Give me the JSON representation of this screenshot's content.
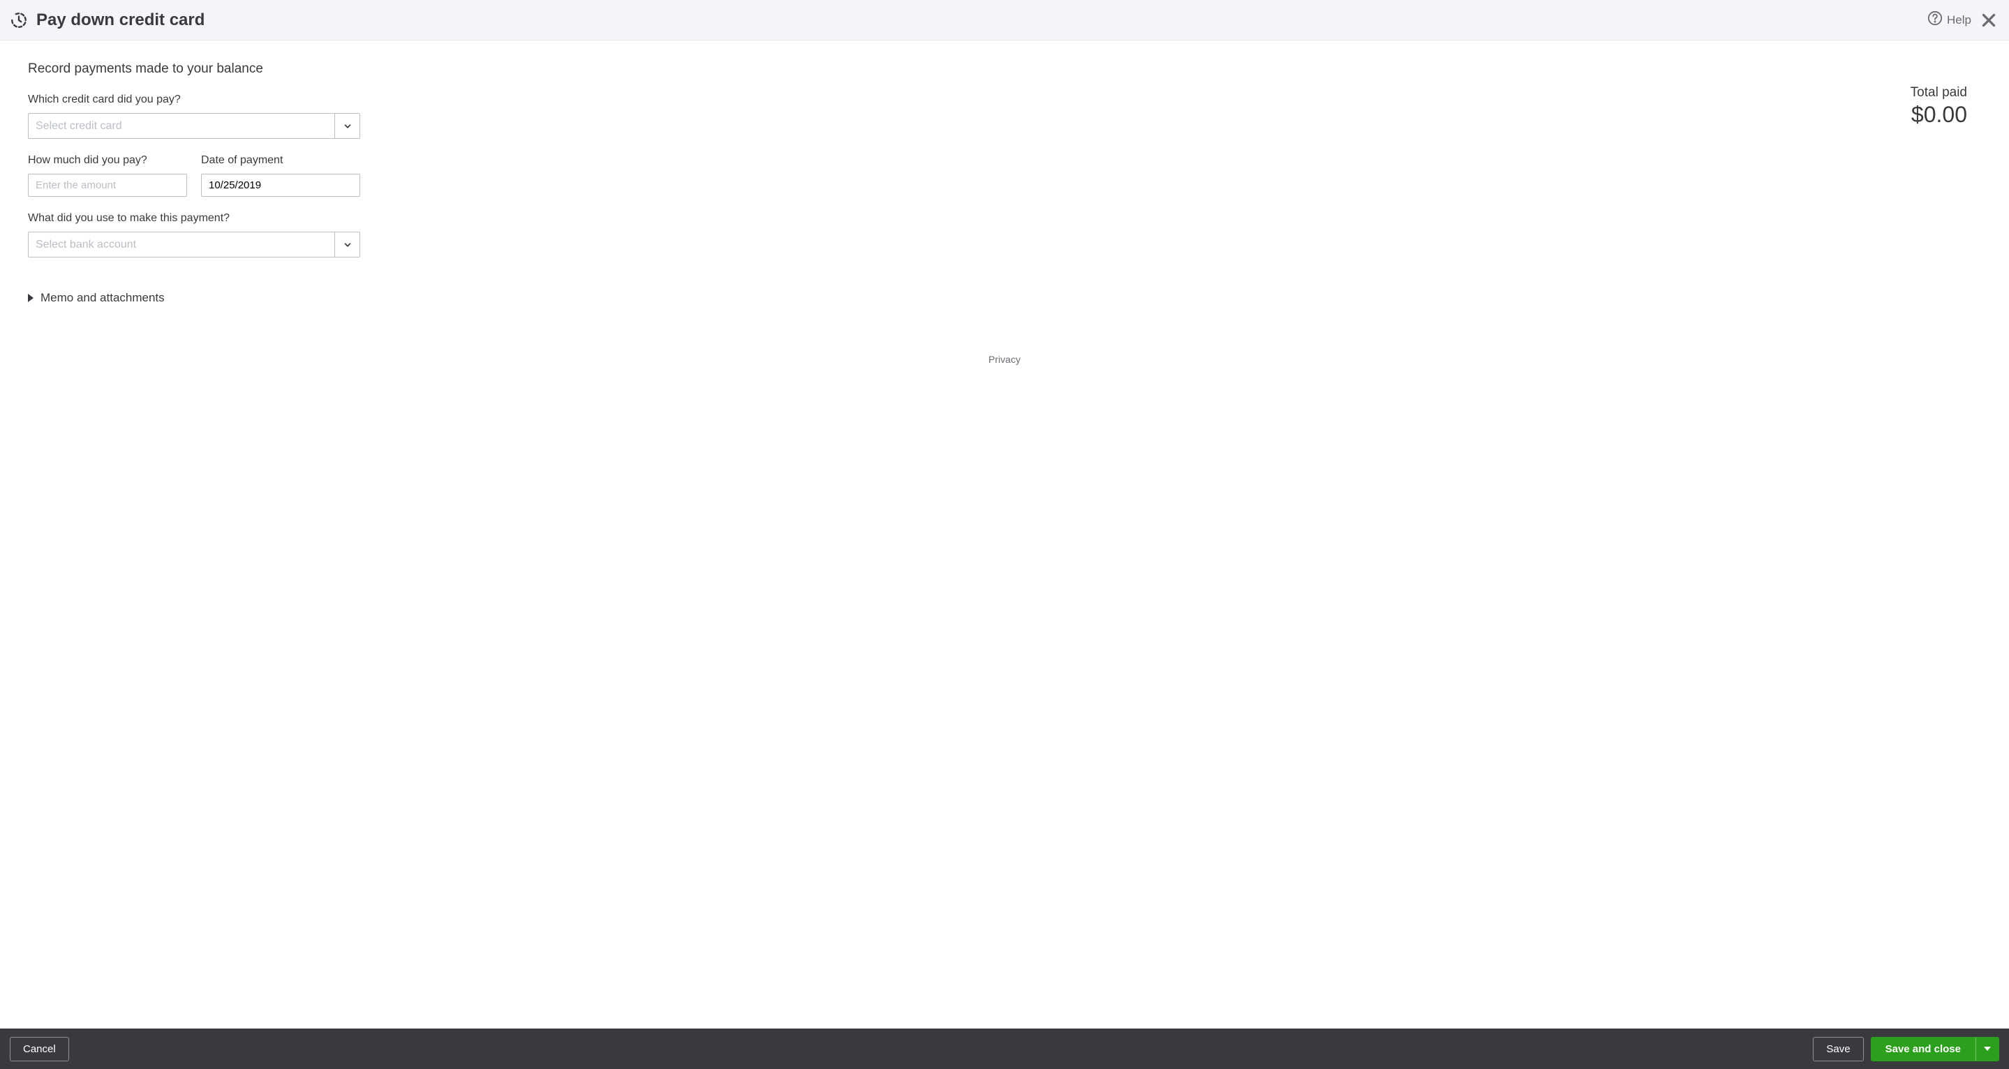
{
  "header": {
    "title": "Pay down credit card",
    "help_label": "Help"
  },
  "content": {
    "subtitle": "Record payments made to your balance",
    "credit_card": {
      "label": "Which credit card did you pay?",
      "placeholder": "Select credit card",
      "value": ""
    },
    "amount": {
      "label": "How much did you pay?",
      "placeholder": "Enter the amount",
      "value": ""
    },
    "date": {
      "label": "Date of payment",
      "value": "10/25/2019"
    },
    "bank": {
      "label": "What did you use to make this payment?",
      "placeholder": "Select bank account",
      "value": ""
    },
    "expander_label": "Memo and attachments",
    "privacy_label": "Privacy"
  },
  "total": {
    "label": "Total paid",
    "value": "$0.00"
  },
  "footer": {
    "cancel": "Cancel",
    "save": "Save",
    "save_close": "Save and close"
  }
}
